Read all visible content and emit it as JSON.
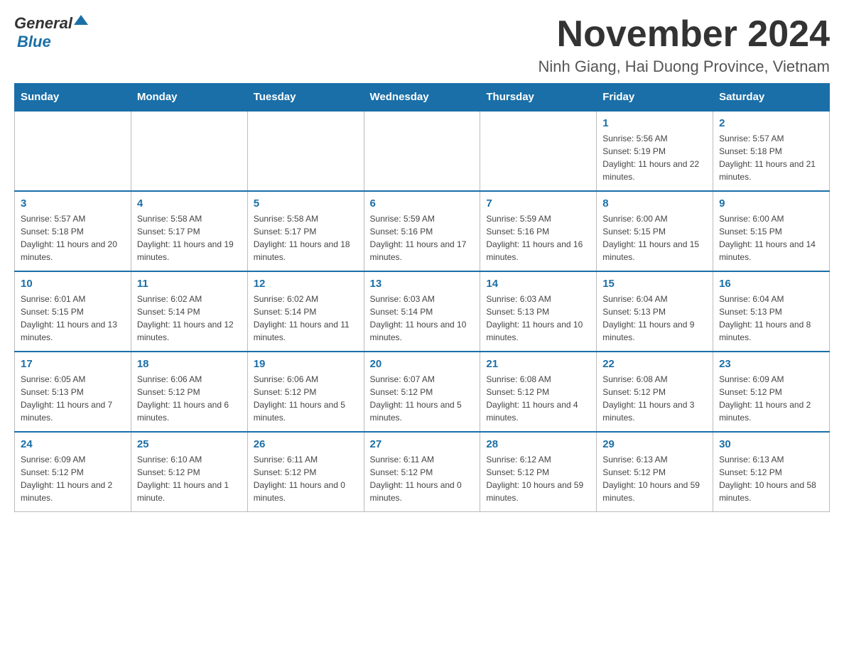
{
  "logo": {
    "general": "General",
    "blue": "Blue"
  },
  "header": {
    "month": "November 2024",
    "location": "Ninh Giang, Hai Duong Province, Vietnam"
  },
  "days_of_week": [
    "Sunday",
    "Monday",
    "Tuesday",
    "Wednesday",
    "Thursday",
    "Friday",
    "Saturday"
  ],
  "weeks": [
    {
      "days": [
        {
          "number": "",
          "sunrise": "",
          "sunset": "",
          "daylight": ""
        },
        {
          "number": "",
          "sunrise": "",
          "sunset": "",
          "daylight": ""
        },
        {
          "number": "",
          "sunrise": "",
          "sunset": "",
          "daylight": ""
        },
        {
          "number": "",
          "sunrise": "",
          "sunset": "",
          "daylight": ""
        },
        {
          "number": "",
          "sunrise": "",
          "sunset": "",
          "daylight": ""
        },
        {
          "number": "1",
          "sunrise": "Sunrise: 5:56 AM",
          "sunset": "Sunset: 5:19 PM",
          "daylight": "Daylight: 11 hours and 22 minutes."
        },
        {
          "number": "2",
          "sunrise": "Sunrise: 5:57 AM",
          "sunset": "Sunset: 5:18 PM",
          "daylight": "Daylight: 11 hours and 21 minutes."
        }
      ]
    },
    {
      "days": [
        {
          "number": "3",
          "sunrise": "Sunrise: 5:57 AM",
          "sunset": "Sunset: 5:18 PM",
          "daylight": "Daylight: 11 hours and 20 minutes."
        },
        {
          "number": "4",
          "sunrise": "Sunrise: 5:58 AM",
          "sunset": "Sunset: 5:17 PM",
          "daylight": "Daylight: 11 hours and 19 minutes."
        },
        {
          "number": "5",
          "sunrise": "Sunrise: 5:58 AM",
          "sunset": "Sunset: 5:17 PM",
          "daylight": "Daylight: 11 hours and 18 minutes."
        },
        {
          "number": "6",
          "sunrise": "Sunrise: 5:59 AM",
          "sunset": "Sunset: 5:16 PM",
          "daylight": "Daylight: 11 hours and 17 minutes."
        },
        {
          "number": "7",
          "sunrise": "Sunrise: 5:59 AM",
          "sunset": "Sunset: 5:16 PM",
          "daylight": "Daylight: 11 hours and 16 minutes."
        },
        {
          "number": "8",
          "sunrise": "Sunrise: 6:00 AM",
          "sunset": "Sunset: 5:15 PM",
          "daylight": "Daylight: 11 hours and 15 minutes."
        },
        {
          "number": "9",
          "sunrise": "Sunrise: 6:00 AM",
          "sunset": "Sunset: 5:15 PM",
          "daylight": "Daylight: 11 hours and 14 minutes."
        }
      ]
    },
    {
      "days": [
        {
          "number": "10",
          "sunrise": "Sunrise: 6:01 AM",
          "sunset": "Sunset: 5:15 PM",
          "daylight": "Daylight: 11 hours and 13 minutes."
        },
        {
          "number": "11",
          "sunrise": "Sunrise: 6:02 AM",
          "sunset": "Sunset: 5:14 PM",
          "daylight": "Daylight: 11 hours and 12 minutes."
        },
        {
          "number": "12",
          "sunrise": "Sunrise: 6:02 AM",
          "sunset": "Sunset: 5:14 PM",
          "daylight": "Daylight: 11 hours and 11 minutes."
        },
        {
          "number": "13",
          "sunrise": "Sunrise: 6:03 AM",
          "sunset": "Sunset: 5:14 PM",
          "daylight": "Daylight: 11 hours and 10 minutes."
        },
        {
          "number": "14",
          "sunrise": "Sunrise: 6:03 AM",
          "sunset": "Sunset: 5:13 PM",
          "daylight": "Daylight: 11 hours and 10 minutes."
        },
        {
          "number": "15",
          "sunrise": "Sunrise: 6:04 AM",
          "sunset": "Sunset: 5:13 PM",
          "daylight": "Daylight: 11 hours and 9 minutes."
        },
        {
          "number": "16",
          "sunrise": "Sunrise: 6:04 AM",
          "sunset": "Sunset: 5:13 PM",
          "daylight": "Daylight: 11 hours and 8 minutes."
        }
      ]
    },
    {
      "days": [
        {
          "number": "17",
          "sunrise": "Sunrise: 6:05 AM",
          "sunset": "Sunset: 5:13 PM",
          "daylight": "Daylight: 11 hours and 7 minutes."
        },
        {
          "number": "18",
          "sunrise": "Sunrise: 6:06 AM",
          "sunset": "Sunset: 5:12 PM",
          "daylight": "Daylight: 11 hours and 6 minutes."
        },
        {
          "number": "19",
          "sunrise": "Sunrise: 6:06 AM",
          "sunset": "Sunset: 5:12 PM",
          "daylight": "Daylight: 11 hours and 5 minutes."
        },
        {
          "number": "20",
          "sunrise": "Sunrise: 6:07 AM",
          "sunset": "Sunset: 5:12 PM",
          "daylight": "Daylight: 11 hours and 5 minutes."
        },
        {
          "number": "21",
          "sunrise": "Sunrise: 6:08 AM",
          "sunset": "Sunset: 5:12 PM",
          "daylight": "Daylight: 11 hours and 4 minutes."
        },
        {
          "number": "22",
          "sunrise": "Sunrise: 6:08 AM",
          "sunset": "Sunset: 5:12 PM",
          "daylight": "Daylight: 11 hours and 3 minutes."
        },
        {
          "number": "23",
          "sunrise": "Sunrise: 6:09 AM",
          "sunset": "Sunset: 5:12 PM",
          "daylight": "Daylight: 11 hours and 2 minutes."
        }
      ]
    },
    {
      "days": [
        {
          "number": "24",
          "sunrise": "Sunrise: 6:09 AM",
          "sunset": "Sunset: 5:12 PM",
          "daylight": "Daylight: 11 hours and 2 minutes."
        },
        {
          "number": "25",
          "sunrise": "Sunrise: 6:10 AM",
          "sunset": "Sunset: 5:12 PM",
          "daylight": "Daylight: 11 hours and 1 minute."
        },
        {
          "number": "26",
          "sunrise": "Sunrise: 6:11 AM",
          "sunset": "Sunset: 5:12 PM",
          "daylight": "Daylight: 11 hours and 0 minutes."
        },
        {
          "number": "27",
          "sunrise": "Sunrise: 6:11 AM",
          "sunset": "Sunset: 5:12 PM",
          "daylight": "Daylight: 11 hours and 0 minutes."
        },
        {
          "number": "28",
          "sunrise": "Sunrise: 6:12 AM",
          "sunset": "Sunset: 5:12 PM",
          "daylight": "Daylight: 10 hours and 59 minutes."
        },
        {
          "number": "29",
          "sunrise": "Sunrise: 6:13 AM",
          "sunset": "Sunset: 5:12 PM",
          "daylight": "Daylight: 10 hours and 59 minutes."
        },
        {
          "number": "30",
          "sunrise": "Sunrise: 6:13 AM",
          "sunset": "Sunset: 5:12 PM",
          "daylight": "Daylight: 10 hours and 58 minutes."
        }
      ]
    }
  ]
}
